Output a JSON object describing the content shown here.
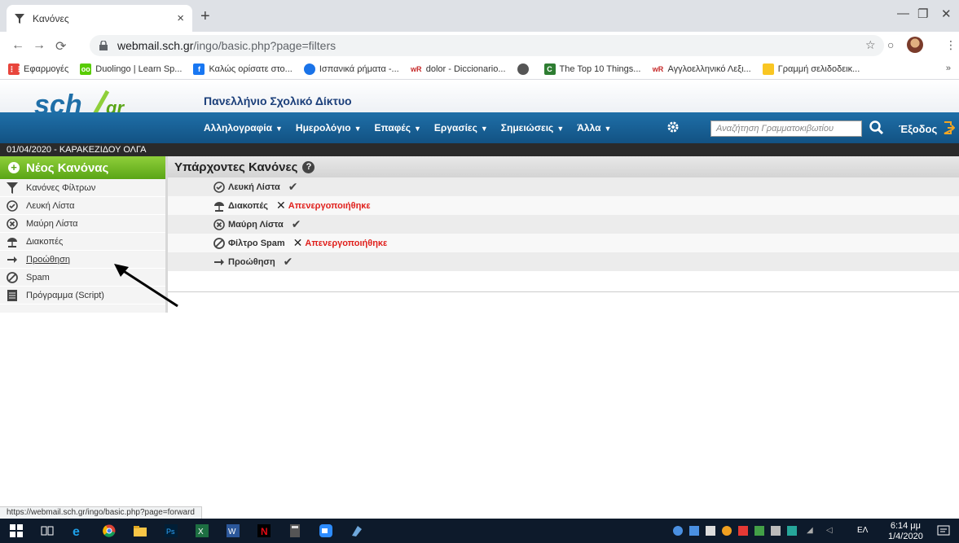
{
  "browser": {
    "tab_title": "Κανόνες",
    "tab_close": "×",
    "new_tab": "+",
    "url_host": "webmail.sch.gr",
    "url_path": "/ingo/basic.php?page=filters",
    "status_url": "https://webmail.sch.gr/ingo/basic.php?page=forward",
    "bookmarks": [
      {
        "label": "Εφαρμογές",
        "icon": "apps-grid-icon",
        "color": "#e8453c"
      },
      {
        "label": "Duolingo | Learn Sp...",
        "icon": "duolingo-icon",
        "color": "#58cc02"
      },
      {
        "label": "Καλώς ορίσατε στο...",
        "icon": "facebook-icon",
        "color": "#1877f2"
      },
      {
        "label": "Ισπανικά ρήματα -...",
        "icon": "chat-bubble-icon",
        "color": "#1a73e8"
      },
      {
        "label": "dolor - Diccionario...",
        "icon": "wordreference-icon",
        "color": "#c62828"
      },
      {
        "label": "",
        "icon": "globe-icon",
        "color": "#555555"
      },
      {
        "label": "The Top 10 Things...",
        "icon": "top10-icon",
        "color": "#2e7d32"
      },
      {
        "label": "Αγγλοελληνικό Λεξι...",
        "icon": "wordreference-icon",
        "color": "#c62828"
      },
      {
        "label": "Γραμμή σελιδοδεικ...",
        "icon": "folder-icon",
        "color": "#f9c623"
      }
    ],
    "bookmarks_more": "»"
  },
  "site": {
    "title": "Πανελλήνιο Σχολικό Δίκτυο",
    "menu": [
      "Αλληλογραφία",
      "Ημερολόγιο",
      "Επαφές",
      "Εργασίες",
      "Σημειώσεις",
      "Άλλα"
    ],
    "search_placeholder": "Αναζήτηση Γραμματοκιβωτίου",
    "logout": "Έξοδος",
    "date_user": "01/04/2020 - ΚΑΡΑΚΕΖΙΔΟΥ ΟΛΓΑ"
  },
  "sidebar": {
    "new_rule": "Νέος Κανόνας",
    "items": [
      {
        "label": "Κανόνες Φίλτρων",
        "icon": "filter-icon"
      },
      {
        "label": "Λευκή Λίστα",
        "icon": "check-circle-icon"
      },
      {
        "label": "Μαύρη Λίστα",
        "icon": "x-circle-icon"
      },
      {
        "label": "Διακοπές",
        "icon": "vacation-icon"
      },
      {
        "label": "Προώθηση",
        "icon": "arrow-right-icon"
      },
      {
        "label": "Spam",
        "icon": "ban-icon"
      },
      {
        "label": "Πρόγραμμα (Script)",
        "icon": "script-icon"
      }
    ]
  },
  "main": {
    "heading": "Υπάρχοντες Κανόνες",
    "help": "?",
    "rules": [
      {
        "label": "Λευκή Λίστα",
        "icon": "check-circle-icon",
        "enabled": true,
        "status": ""
      },
      {
        "label": "Διακοπές",
        "icon": "vacation-icon",
        "enabled": false,
        "status": "Απενεργοποιήθηκε"
      },
      {
        "label": "Μαύρη Λίστα",
        "icon": "x-circle-icon",
        "enabled": true,
        "status": ""
      },
      {
        "label": "Φίλτρο Spam",
        "icon": "ban-icon",
        "enabled": false,
        "status": "Απενεργοποιήθηκε"
      },
      {
        "label": "Προώθηση",
        "icon": "arrow-right-icon",
        "enabled": true,
        "status": ""
      }
    ]
  },
  "taskbar": {
    "lang": "ΕΛ",
    "time": "6:14 μμ",
    "date": "1/4/2020"
  },
  "colors": {
    "nav_blue": "#125283",
    "accent_green": "#5aa516",
    "disabled_red": "#e0201c"
  }
}
